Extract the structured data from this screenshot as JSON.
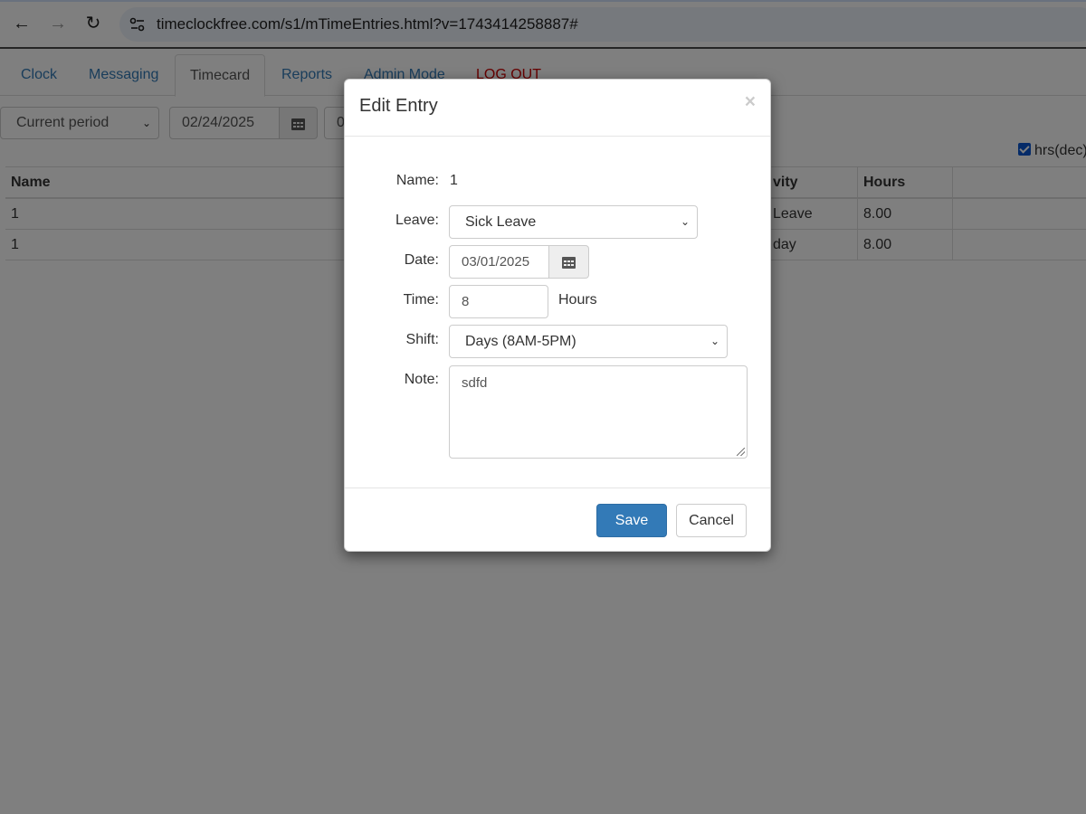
{
  "browser": {
    "url": "timeclockfree.com/s1/mTimeEntries.html?v=1743414258887#",
    "back_icon": "←",
    "forward_icon": "→",
    "reload_icon": "↻"
  },
  "tabs": [
    {
      "label": "Clock"
    },
    {
      "label": "Messaging"
    },
    {
      "label": "Timecard"
    },
    {
      "label": "Reports"
    },
    {
      "label": "Admin Mode"
    },
    {
      "label": "LOG OUT"
    }
  ],
  "toolbar": {
    "period": "Current period",
    "start_date": "02/24/2025",
    "end_date_partial": "0",
    "hrs_dec_label": "hrs(dec)"
  },
  "table": {
    "headers": {
      "name": "Name",
      "activity": "vity",
      "hours": "Hours"
    },
    "rows": [
      {
        "name": "1",
        "activity": " Leave",
        "hours": "8.00"
      },
      {
        "name": "1",
        "activity": "day",
        "hours": "8.00"
      }
    ]
  },
  "modal": {
    "title": "Edit Entry",
    "close": "×",
    "name_label": "Name:",
    "name_value": "1",
    "leave_label": "Leave:",
    "leave_value": "Sick Leave",
    "date_label": "Date:",
    "date_value": "03/01/2025",
    "time_label": "Time:",
    "time_value": "8",
    "time_unit": "Hours",
    "shift_label": "Shift:",
    "shift_value": "Days (8AM-5PM)",
    "note_label": "Note:",
    "note_value": "sdfd",
    "save_label": "Save",
    "cancel_label": "Cancel"
  },
  "colors": {
    "primary": "#337ab7",
    "link": "#337ab7",
    "logout": "#cc0000",
    "backdrop": "#808080"
  }
}
